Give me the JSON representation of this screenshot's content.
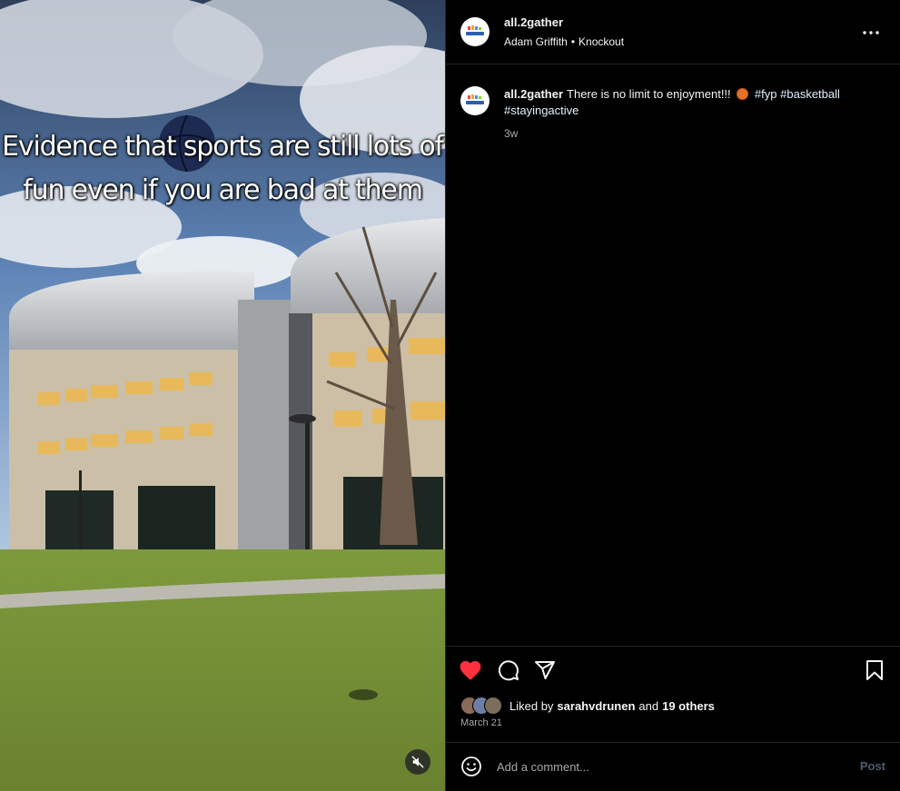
{
  "post": {
    "media": {
      "overlay_line1": "Evidence that sports are still lots of",
      "overlay_line2": "fun even if you are bad at them",
      "mute_icon": "speaker-muted-icon"
    },
    "header": {
      "username": "all.2gather",
      "music_artist": "Adam Griffith",
      "separator": "•",
      "music_track": "Knockout",
      "more_icon": "more-horizontal-icon"
    },
    "caption": {
      "username": "all.2gather",
      "text": "There is no limit to enjoyment!!!",
      "emoji": "basketball-emoji",
      "hashtags": [
        "#fyp",
        "#basketball",
        "#stayingactive"
      ],
      "time": "3w"
    },
    "actions": {
      "like_icon": "heart-filled-icon",
      "comment_icon": "comment-icon",
      "share_icon": "send-icon",
      "save_icon": "bookmark-icon",
      "liked": true
    },
    "likes": {
      "prefix": "Liked by",
      "user": "sarahvdrunen",
      "and": "and",
      "others": "19 others"
    },
    "date": "March 21",
    "comment_box": {
      "emoji_icon": "smiley-icon",
      "placeholder": "Add a comment...",
      "post_label": "Post"
    },
    "colors": {
      "background": "#000000",
      "text": "#f5f5f5",
      "secondary_text": "#a8a8a8",
      "like_red": "#ff3040",
      "divider": "#262626"
    }
  }
}
